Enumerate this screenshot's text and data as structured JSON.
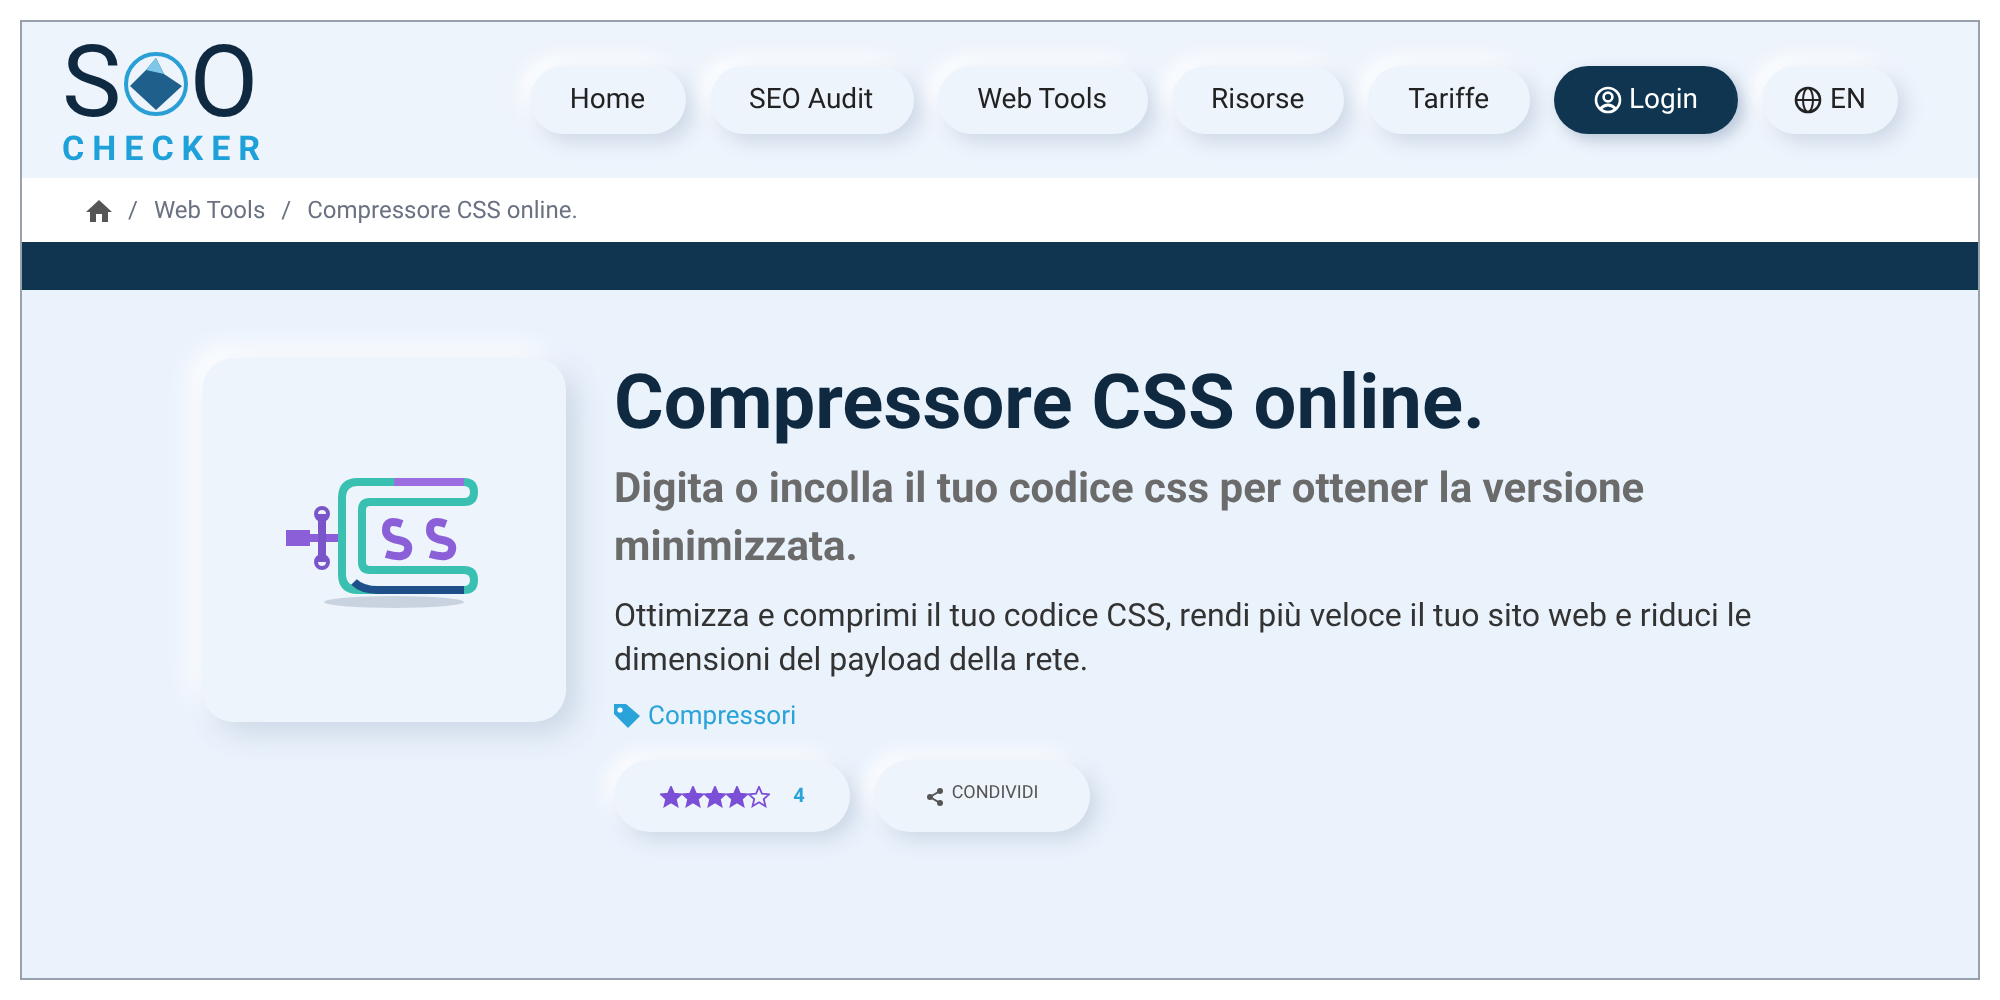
{
  "logo": {
    "left": "S",
    "right": "O",
    "subtitle": "CHECKER"
  },
  "nav": [
    {
      "label": "Home",
      "kind": "link",
      "selected": false
    },
    {
      "label": "SEO Audit",
      "kind": "link",
      "selected": false
    },
    {
      "label": "Web Tools",
      "kind": "link",
      "selected": false
    },
    {
      "label": "Risorse",
      "kind": "link",
      "selected": false
    },
    {
      "label": "Tariffe",
      "kind": "link",
      "selected": false
    },
    {
      "label": "Login",
      "kind": "login",
      "selected": true
    },
    {
      "label": "EN",
      "kind": "language",
      "selected": false
    }
  ],
  "breadcrumb": {
    "separator": "/",
    "items": [
      "Web Tools",
      "Compressore CSS online."
    ]
  },
  "tool": {
    "title": "Compressore CSS online.",
    "subtitle": "Digita o incolla il tuo codice css per ottener la versione minimizzata.",
    "description": "Ottimizza e comprimi il tuo codice CSS, rendi più veloce il tuo sito web e riduci le dimensioni del payload della rete.",
    "tag": "Compressori",
    "stars": 4,
    "rating": "4",
    "share": "CONDIVIDI"
  }
}
